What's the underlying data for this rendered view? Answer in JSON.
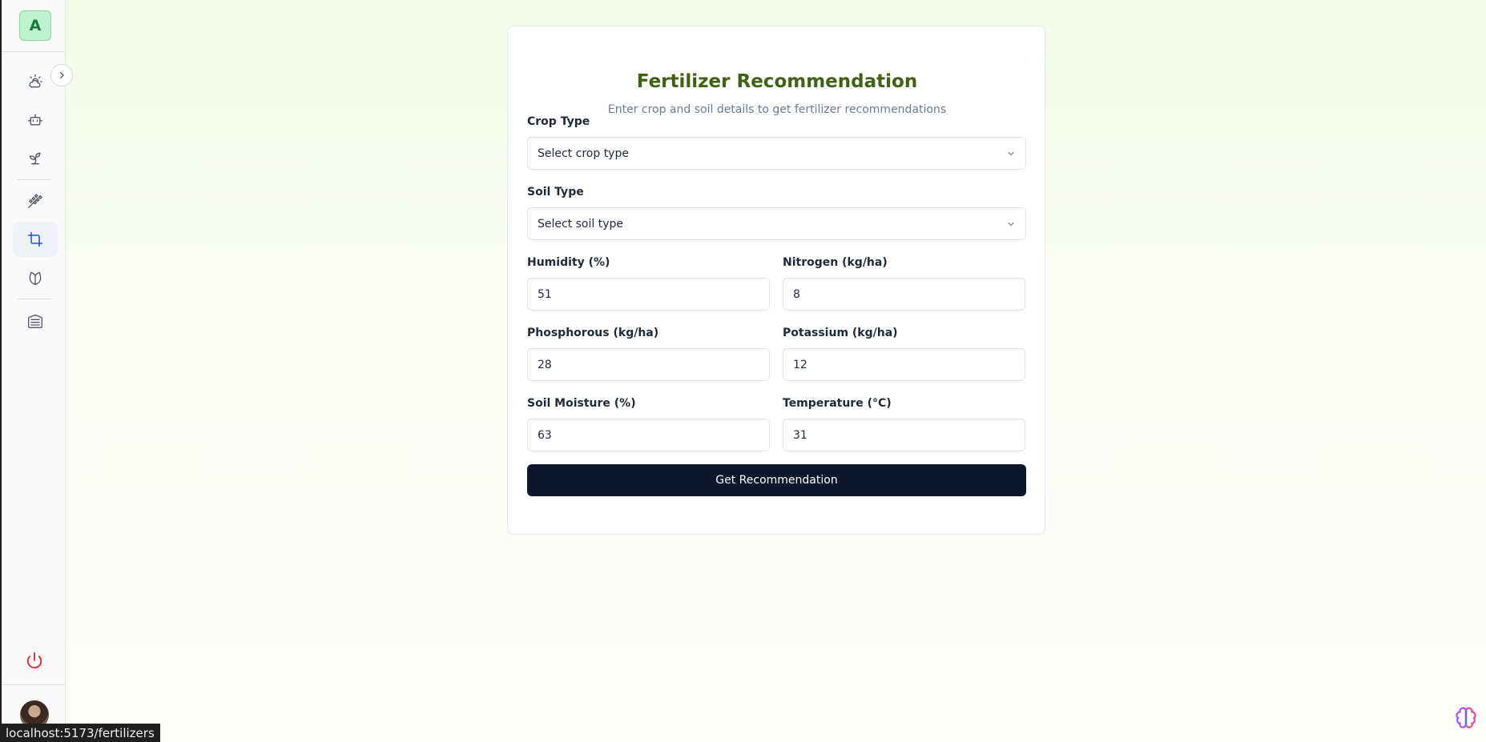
{
  "sidebar": {
    "avatar_letter": "A",
    "items": [
      {
        "icon": "weather-icon",
        "active": false
      },
      {
        "icon": "bot-icon",
        "active": false
      },
      {
        "icon": "sprout-icon",
        "active": false
      },
      {
        "icon": "wheat-icon",
        "active": false
      },
      {
        "icon": "crop-icon",
        "active": true
      },
      {
        "icon": "leaf-icon",
        "active": false
      },
      {
        "icon": "warehouse-icon",
        "active": false
      }
    ],
    "logout_icon": "power-icon"
  },
  "form": {
    "title": "Fertilizer Recommendation",
    "subtitle": "Enter crop and soil details to get fertilizer recommendations",
    "crop_type": {
      "label": "Crop Type",
      "placeholder": "Select crop type"
    },
    "soil_type": {
      "label": "Soil Type",
      "placeholder": "Select soil type"
    },
    "humidity": {
      "label": "Humidity (%)",
      "value": "51"
    },
    "nitrogen": {
      "label": "Nitrogen (kg/ha)",
      "value": "8"
    },
    "phosphorous": {
      "label": "Phosphorous (kg/ha)",
      "value": "28"
    },
    "potassium": {
      "label": "Potassium (kg/ha)",
      "value": "12"
    },
    "soil_moisture": {
      "label": "Soil Moisture (%)",
      "value": "63"
    },
    "temperature": {
      "label": "Temperature (°C)",
      "value": "31"
    },
    "submit_label": "Get Recommendation"
  },
  "status_bar": {
    "url": "localhost:5173/fertilizers"
  },
  "colors": {
    "accent_title": "#3f6212",
    "button_bg": "#0f172a",
    "active_icon": "#1d4ed8",
    "logout": "#dc2626"
  }
}
